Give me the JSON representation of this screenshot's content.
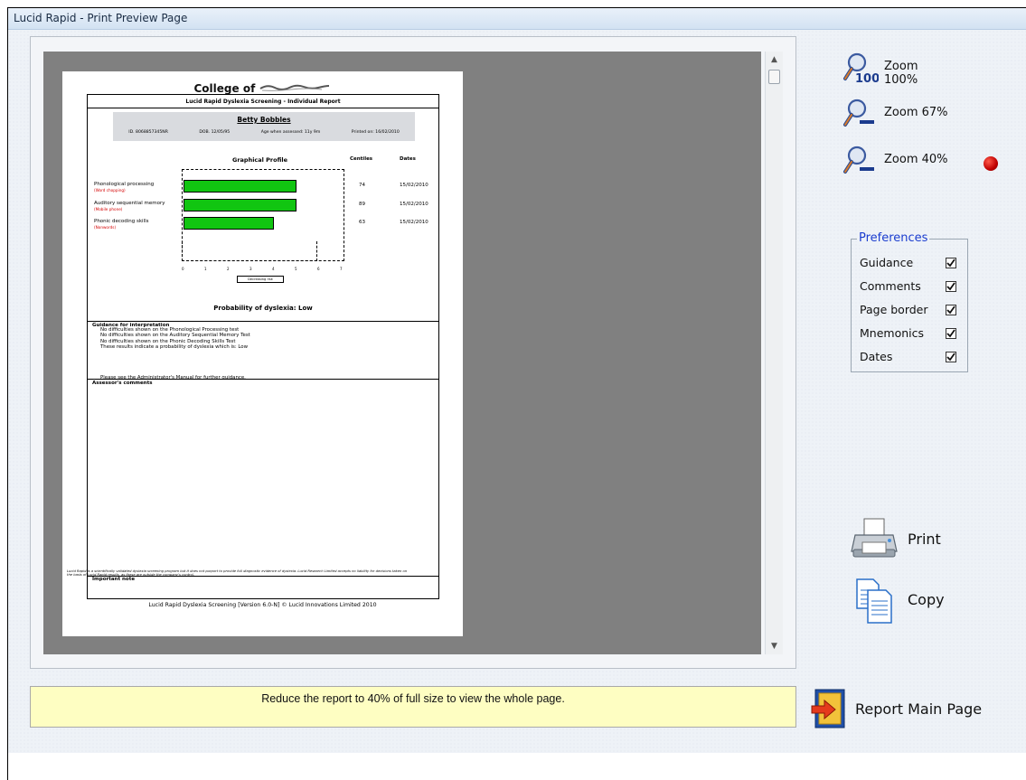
{
  "window": {
    "title": "Lucid Rapid - Print Preview Page"
  },
  "report": {
    "college_prefix": "College of",
    "college_logo_text": "SomeCollege",
    "title": "Lucid Rapid Dyslexia Screening - Individual Report",
    "student_name": "Betty Bobbles",
    "id": "ID. 8068857345NR",
    "dob": "DOB. 12/05/95",
    "age": "Age when assessed: 11y 9m",
    "printed": "Printed on: 16/02/2010",
    "graph_title": "Graphical Profile",
    "col_centiles": "Centiles",
    "col_dates": "Dates",
    "tests": [
      {
        "name": "Phonological processing",
        "sub": "(Word chopping)",
        "score": 5,
        "centile": "74",
        "date": "15/02/2010"
      },
      {
        "name": "Auditory sequential memory",
        "sub": "(Mobile phone)",
        "score": 5,
        "centile": "89",
        "date": "15/02/2010"
      },
      {
        "name": "Phonic decoding skills",
        "sub": "(Nonwords)",
        "score": 4,
        "centile": "63",
        "date": "15/02/2010"
      }
    ],
    "axis_ticks": [
      "0",
      "1",
      "2",
      "3",
      "4",
      "5",
      "6",
      "7"
    ],
    "axis_arrow": "Decreasing risk",
    "probability": "Probability of dyslexia:     Low",
    "guidance_head": "Guidance for interpretation",
    "guidance_lines": [
      "No difficulties shown on the Phonological Processing test",
      "No difficulties shown on the Auditory Sequential Memory Test",
      "No difficulties shown on the Phonic Decoding Skills Test",
      "These results indicate a probability of dyslexia which is:  Low"
    ],
    "guidance_more": "Please see the Administrator's Manual for further guidance.",
    "comments_head": "Assessor's comments",
    "note_head": "Important note",
    "note_text": "Lucid Rapid is a scientifically validated dyslexia screening program but it does not purport to provide full diagnostic evidence of dyslexia. Lucid Research Limited accepts no liability for decisions taken on the basis of Lucid Rapid results, as these are outside the company's control.",
    "footer": "Lucid Rapid Dyslexia Screening [Version 6.0-N]  © Lucid Innovations Limited 2010"
  },
  "zoom": {
    "z100": "Zoom 100%",
    "z67": "Zoom 67%",
    "z40": "Zoom 40%",
    "mag_100_text": "100",
    "active": "Zoom 40%"
  },
  "preferences": {
    "legend": "Preferences",
    "items": [
      {
        "label": "Guidance",
        "checked": true
      },
      {
        "label": "Comments",
        "checked": true
      },
      {
        "label": "Page border",
        "checked": true
      },
      {
        "label": "Mnemonics",
        "checked": true
      },
      {
        "label": "Dates",
        "checked": true
      }
    ]
  },
  "actions": {
    "print": "Print",
    "copy": "Copy",
    "report_main": "Report Main Page"
  },
  "status": {
    "message": "Reduce the report to 40% of full size to view the whole page."
  },
  "colors": {
    "bar": "#11c511",
    "indicator": "#cc0000",
    "legend": "#1a3ccf",
    "status_bg": "#fefec2"
  }
}
